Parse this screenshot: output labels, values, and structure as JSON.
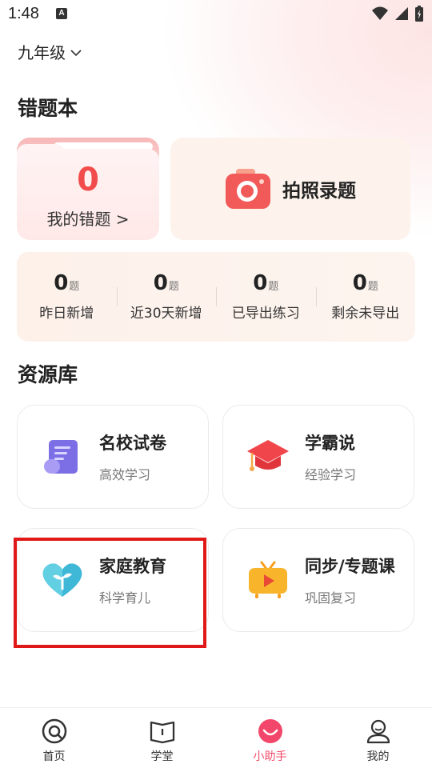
{
  "status_bar": {
    "time": "1:48",
    "notification_badge": "A"
  },
  "grade_selector": {
    "label": "九年级"
  },
  "mistake_section": {
    "title": "错题本",
    "my_mistakes": {
      "count": "0",
      "label": "我的错题 >"
    },
    "photo_entry": {
      "label": "拍照录题"
    },
    "stats": [
      {
        "value": "0",
        "unit": "题",
        "label": "昨日新增"
      },
      {
        "value": "0",
        "unit": "题",
        "label": "近30天新增"
      },
      {
        "value": "0",
        "unit": "题",
        "label": "已导出练习"
      },
      {
        "value": "0",
        "unit": "题",
        "label": "剩余未导出"
      }
    ]
  },
  "resource_section": {
    "title": "资源库",
    "cards": [
      {
        "title": "名校试卷",
        "subtitle": "高效学习",
        "icon": "scroll-icon"
      },
      {
        "title": "学霸说",
        "subtitle": "经验学习",
        "icon": "graduation-cap-icon"
      },
      {
        "title": "家庭教育",
        "subtitle": "科学育儿",
        "icon": "heart-sprout-icon"
      },
      {
        "title": "同步/专题课",
        "subtitle": "巩固复习",
        "icon": "video-play-icon"
      }
    ]
  },
  "bottom_nav": {
    "items": [
      {
        "label": "首页",
        "icon": "home-icon"
      },
      {
        "label": "学堂",
        "icon": "book-icon"
      },
      {
        "label": "小助手",
        "icon": "assistant-icon",
        "active": true
      },
      {
        "label": "我的",
        "icon": "profile-icon"
      }
    ]
  },
  "colors": {
    "accent": "#f24b4b",
    "active_nav": "#f24b6a",
    "highlight_box": "#e01818"
  }
}
